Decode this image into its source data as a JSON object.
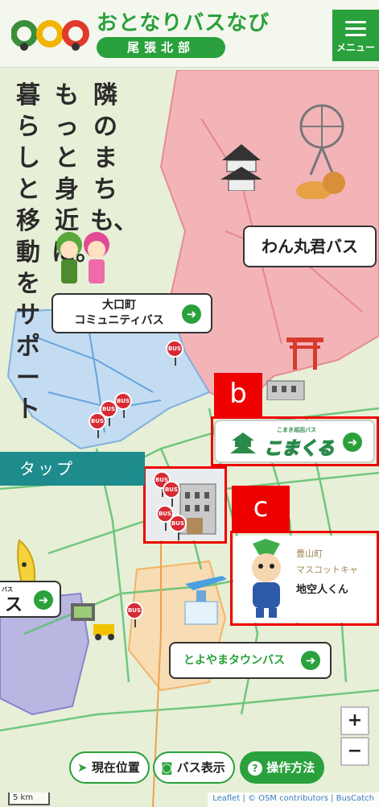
{
  "header": {
    "title": "おとなりバスなび",
    "subtitle": "尾張北部",
    "menu_label": "メニュー"
  },
  "tagline": {
    "columns": [
      "隣のまちも、",
      "もっと身近に。",
      "暮らしと移動をサポート"
    ]
  },
  "map": {
    "cards": {
      "wanmaru": "わん丸君バス",
      "oguchi_line1": "大口町",
      "oguchi_line2": "コミュニティバス",
      "komakuru": "こまくる",
      "komakuru_small": "こまき巡回バス",
      "toyoyama": "とよやまタウンバス",
      "left_partial": "ス",
      "left_partial_small": "バス",
      "mascot_town": "豊山町",
      "mascot_role": "マスコットキャ",
      "mascot_name": "地空人くん"
    },
    "bus_pin_label": "BUS",
    "annotations": {
      "tap": "タップ",
      "b": "b",
      "c": "c"
    },
    "controls": {
      "current_location": "現在位置",
      "show_bus": "バス表示",
      "how_to": "操作方法",
      "zoom_in": "+",
      "zoom_out": "−"
    },
    "scale": "5 km",
    "attribution": "Leaflet | © OSM contributors | BusCatch"
  },
  "colors": {
    "brand_green": "#2aa13c",
    "annotation_red": "#e00000",
    "tap_teal": "#1e8c8c"
  }
}
